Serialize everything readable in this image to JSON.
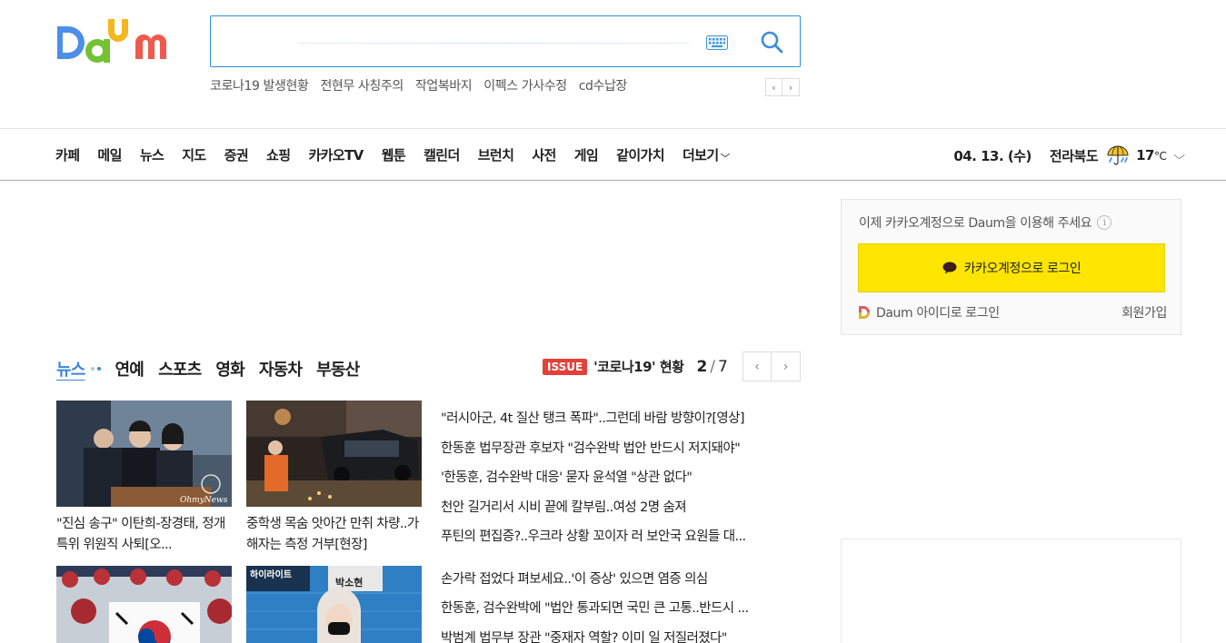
{
  "logo": {
    "text": "Daum",
    "colors": [
      "#4d8ee8",
      "#73c234",
      "#f3b71f",
      "#ef5a4c"
    ]
  },
  "search": {
    "value": "",
    "placeholder": ""
  },
  "trending": [
    "코로나19 발생현황",
    "전현무 사칭주의",
    "작업복바지",
    "이펙스 가사수정",
    "cd수납장"
  ],
  "nav": {
    "items": [
      "카페",
      "메일",
      "뉴스",
      "지도",
      "증권",
      "쇼핑",
      "카카오TV",
      "웹툰",
      "캘린더",
      "브런치",
      "사전",
      "게임",
      "같이가치"
    ],
    "more_label": "더보기",
    "date": "04. 13. (수)",
    "region": "전라북도",
    "temp": "17",
    "temp_unit": "°C",
    "weather_icon": "rain-umbrella-icon"
  },
  "login": {
    "info": "이제 카카오계정으로 Daum을 이용해 주세요",
    "kakao_button": "카카오계정으로 로그인",
    "daum_id": "Daum 아이디로 로그인",
    "join": "회원가입",
    "accent": "#fee500"
  },
  "news": {
    "tabs": [
      "뉴스",
      "연예",
      "스포츠",
      "영화",
      "자동차",
      "부동산"
    ],
    "issue_badge": "ISSUE",
    "issue_title": "'코로나19' 현황",
    "page_current": "2",
    "page_sep": "/",
    "page_total": "7",
    "thumbs": [
      {
        "caption": "\"진심 송구\" 이탄희-장경태, 정개특위 위원직 사퇴[오...",
        "watermark": "OhmyNews"
      },
      {
        "caption": "중학생 목숨 앗아간 만취 차량..가해자는 측정 거부[현장]"
      },
      {
        "caption": ""
      },
      {
        "caption": ""
      }
    ],
    "thumb3_sign": "하이라이트",
    "thumb3_sign2": "박소현",
    "headlines": [
      "\"러시아군, 4t 질산 탱크 폭파\"..그런데 바람 방향이?[영상]",
      "한동훈 법무장관 후보자 \"검수완박 법안 반드시 저지돼야\"",
      "'한동훈, 검수완박 대응' 묻자 윤석열 \"상관 없다\"",
      "천안 길거리서 시비 끝에 칼부림..여성 2명 숨져",
      "푸틴의 편집증?..우크라 상황 꼬이자 러 보안국 요원들 대...",
      "손가락 접었다 펴보세요..'이 증상' 있으면 염증 의심",
      "한동훈, 검수완박에 \"법안 통과되면 국민 큰 고통..반드시 ...",
      "박범계 법무부 장관 \"중재자 역할? 이미 일 저질러졌다\""
    ]
  }
}
